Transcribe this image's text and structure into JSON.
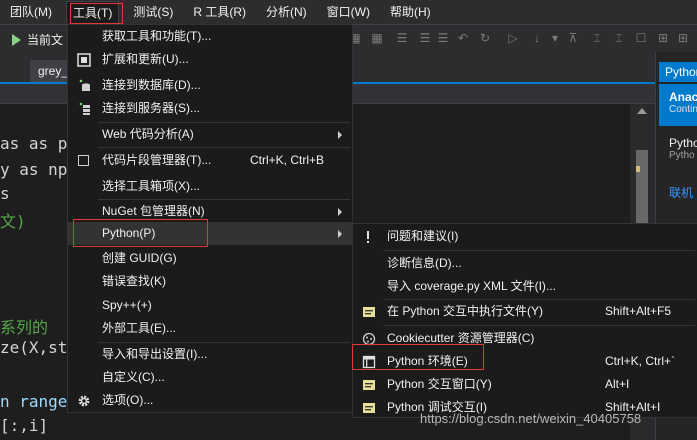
{
  "menubar": {
    "items": [
      "团队(M)",
      "工具(T)",
      "测试(S)",
      "R 工具(R)",
      "分析(N)",
      "窗口(W)",
      "帮助(H)"
    ],
    "active_index": 1
  },
  "toolbar": {
    "start_label": "当前文"
  },
  "tabs": {
    "file_tab": "grey_"
  },
  "editor": {
    "lines": [
      "as as p",
      "y as np",
      "s",
      "文)",
      "",
      "",
      "系列的",
      "ze(X,st",
      "",
      "n range",
      "[:,i]"
    ]
  },
  "right_panel": {
    "tab_label": "Python",
    "card_title": "Anaco",
    "card_subtitle": "Contin",
    "line1": "Pytho",
    "line2": "Pytho",
    "link": "联机"
  },
  "tools_menu": {
    "items": [
      {
        "label": "获取工具和功能(T)...",
        "shortcut": "",
        "submenu": false,
        "icon": ""
      },
      {
        "label": "扩展和更新(U)...",
        "shortcut": "",
        "submenu": false,
        "icon": "extensions-icon"
      },
      {
        "label": "连接到数据库(D)...",
        "shortcut": "",
        "submenu": false,
        "icon": "database-icon"
      },
      {
        "label": "连接到服务器(S)...",
        "shortcut": "",
        "submenu": false,
        "icon": "server-icon"
      },
      {
        "label": "Web 代码分析(A)",
        "shortcut": "",
        "submenu": true,
        "icon": ""
      },
      {
        "label": "代码片段管理器(T)...",
        "shortcut": "Ctrl+K, Ctrl+B",
        "submenu": false,
        "icon": "snippet-checkbox-icon"
      },
      {
        "label": "选择工具箱项(X)...",
        "shortcut": "",
        "submenu": false,
        "icon": ""
      },
      {
        "label": "NuGet 包管理器(N)",
        "shortcut": "",
        "submenu": true,
        "icon": ""
      },
      {
        "label": "Python(P)",
        "shortcut": "",
        "submenu": true,
        "icon": ""
      },
      {
        "label": "创建 GUID(G)",
        "shortcut": "",
        "submenu": false,
        "icon": ""
      },
      {
        "label": "错误查找(K)",
        "shortcut": "",
        "submenu": false,
        "icon": ""
      },
      {
        "label": "Spy++(+)",
        "shortcut": "",
        "submenu": false,
        "icon": ""
      },
      {
        "label": "外部工具(E)...",
        "shortcut": "",
        "submenu": false,
        "icon": ""
      },
      {
        "label": "导入和导出设置(I)...",
        "shortcut": "",
        "submenu": false,
        "icon": ""
      },
      {
        "label": "自定义(C)...",
        "shortcut": "",
        "submenu": false,
        "icon": ""
      },
      {
        "label": "选项(O)...",
        "shortcut": "",
        "submenu": false,
        "icon": "gear-icon"
      }
    ]
  },
  "python_menu": {
    "items": [
      {
        "label": "问题和建议(I)",
        "shortcut": "",
        "icon": "feedback-icon"
      },
      {
        "label": "诊断信息(D)...",
        "shortcut": "",
        "icon": ""
      },
      {
        "label": "导入 coverage.py XML 文件(I)...",
        "shortcut": "",
        "icon": ""
      },
      {
        "label": "在 Python 交互中执行文件(Y)",
        "shortcut": "Shift+Alt+F5",
        "icon": "interactive-window-icon"
      },
      {
        "label": "Cookiecutter 资源管理器(C)",
        "shortcut": "",
        "icon": "cookiecutter-icon"
      },
      {
        "label": "Python 环境(E)",
        "shortcut": "Ctrl+K, Ctrl+`",
        "icon": "environments-icon"
      },
      {
        "label": "Python 交互窗口(Y)",
        "shortcut": "Alt+I",
        "icon": "interactive-window-icon"
      },
      {
        "label": "Python 调试交互(I)",
        "shortcut": "Shift+Alt+I",
        "icon": "debug-interactive-icon"
      }
    ]
  },
  "watermark": "https://blog.csdn.net/weixin_40405758",
  "colors": {
    "accent": "#007acc",
    "highlight_box": "#e03a3a",
    "menu_bg": "#1b1b1c"
  }
}
